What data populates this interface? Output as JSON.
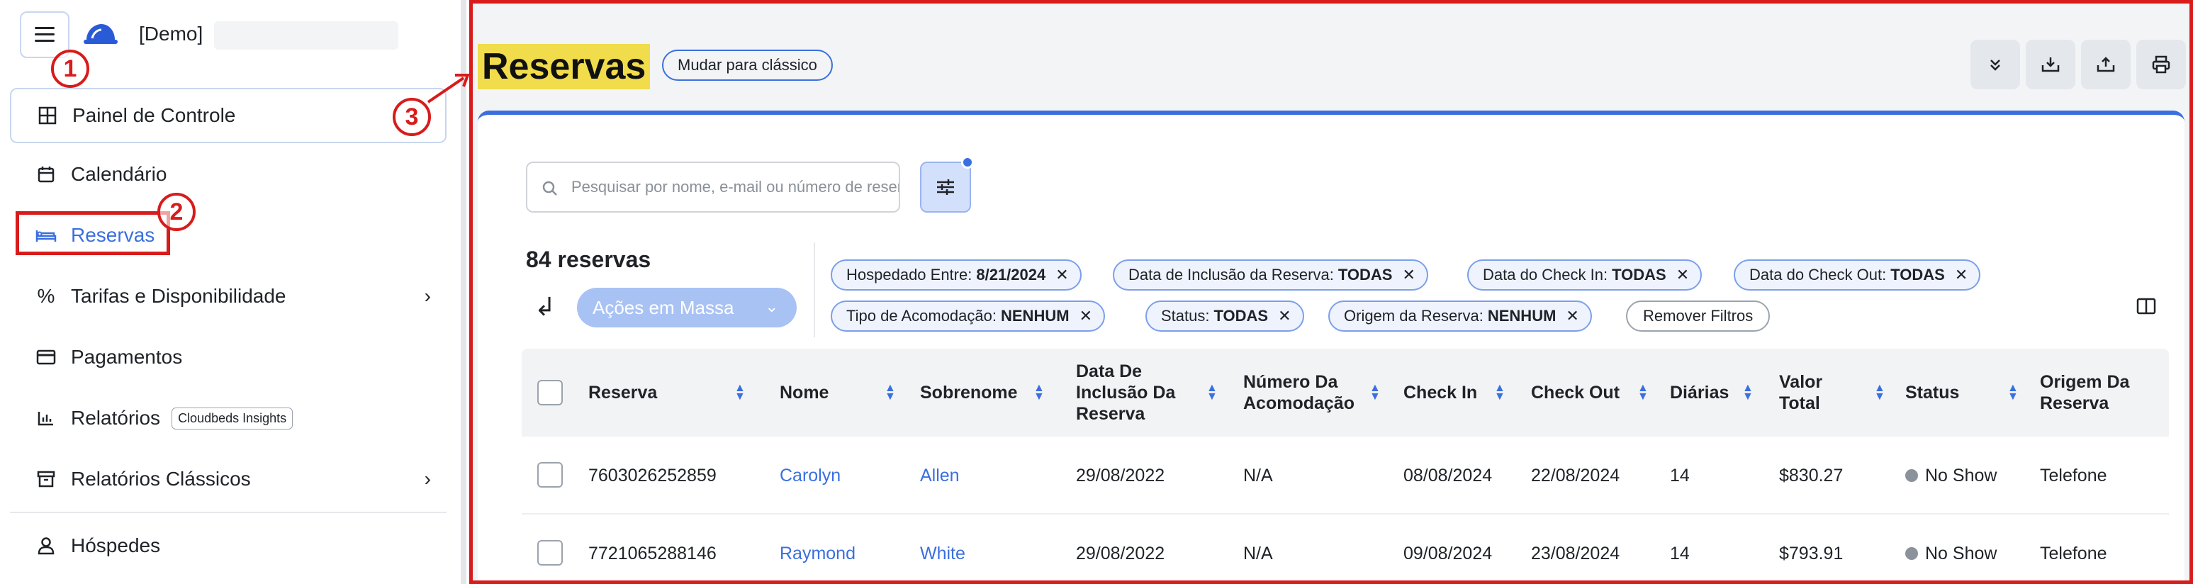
{
  "header": {
    "property_name": "[Demo]"
  },
  "sidebar": {
    "items": [
      {
        "label": "Painel de Controle",
        "icon": "grid-icon"
      },
      {
        "label": "Calendário",
        "icon": "calendar-icon"
      },
      {
        "label": "Reservas",
        "icon": "bed-icon",
        "active": true
      },
      {
        "label": "Tarifas e Disponibilidade",
        "icon": "percent-icon",
        "has_submenu": true
      },
      {
        "label": "Pagamentos",
        "icon": "credit-card-icon"
      },
      {
        "label": "Relatórios",
        "icon": "bar-chart-icon",
        "badge": "Cloudbeds Insights"
      },
      {
        "label": "Relatórios Clássicos",
        "icon": "archive-icon",
        "has_submenu": true
      },
      {
        "label": "Hóspedes",
        "icon": "user-icon"
      }
    ]
  },
  "annotations": {
    "marker1": "1",
    "marker2": "2",
    "marker3": "3",
    "color": "#d81b1b"
  },
  "main": {
    "title": "Reservas",
    "switch_button": "Mudar para clássico",
    "toolbar": [
      "collapse-icon",
      "download-icon",
      "upload-icon",
      "print-icon"
    ],
    "search": {
      "placeholder": "Pesquisar por nome, e-mail ou número de reserva"
    },
    "count": "84 reservas",
    "mass_actions": "Ações em Massa",
    "filters": [
      {
        "key": "Hospedado Entre:",
        "value": "8/21/2024"
      },
      {
        "key": "Data de Inclusão da Reserva:",
        "value": "TODAS"
      },
      {
        "key": "Data do Check In:",
        "value": "TODAS"
      },
      {
        "key": "Data do Check Out:",
        "value": "TODAS"
      },
      {
        "key": "Tipo de Acomodação:",
        "value": "NENHUM"
      },
      {
        "key": "Status:",
        "value": "TODAS"
      },
      {
        "key": "Origem da Reserva:",
        "value": "NENHUM"
      }
    ],
    "remove_filters": "Remover Filtros",
    "table": {
      "columns": [
        "Reserva",
        "Nome",
        "Sobrenome",
        "Data De Inclusão Da Reserva",
        "Número Da Acomodação",
        "Check In",
        "Check Out",
        "Diárias",
        "Valor Total",
        "Status",
        "Origem Da Reserva"
      ],
      "rows": [
        [
          "7603026252859",
          "Carolyn",
          "Allen",
          "29/08/2022",
          "N/A",
          "08/08/2024",
          "22/08/2024",
          "14",
          "$830.27",
          "No Show",
          "Telefone"
        ],
        [
          "7721065288146",
          "Raymond",
          "White",
          "29/08/2022",
          "N/A",
          "09/08/2024",
          "23/08/2024",
          "14",
          "$793.91",
          "No Show",
          "Telefone"
        ]
      ]
    }
  },
  "colors": {
    "accent": "#3a6fe0",
    "highlight": "#f1dc4b",
    "status_no_show": "#8b929a"
  }
}
